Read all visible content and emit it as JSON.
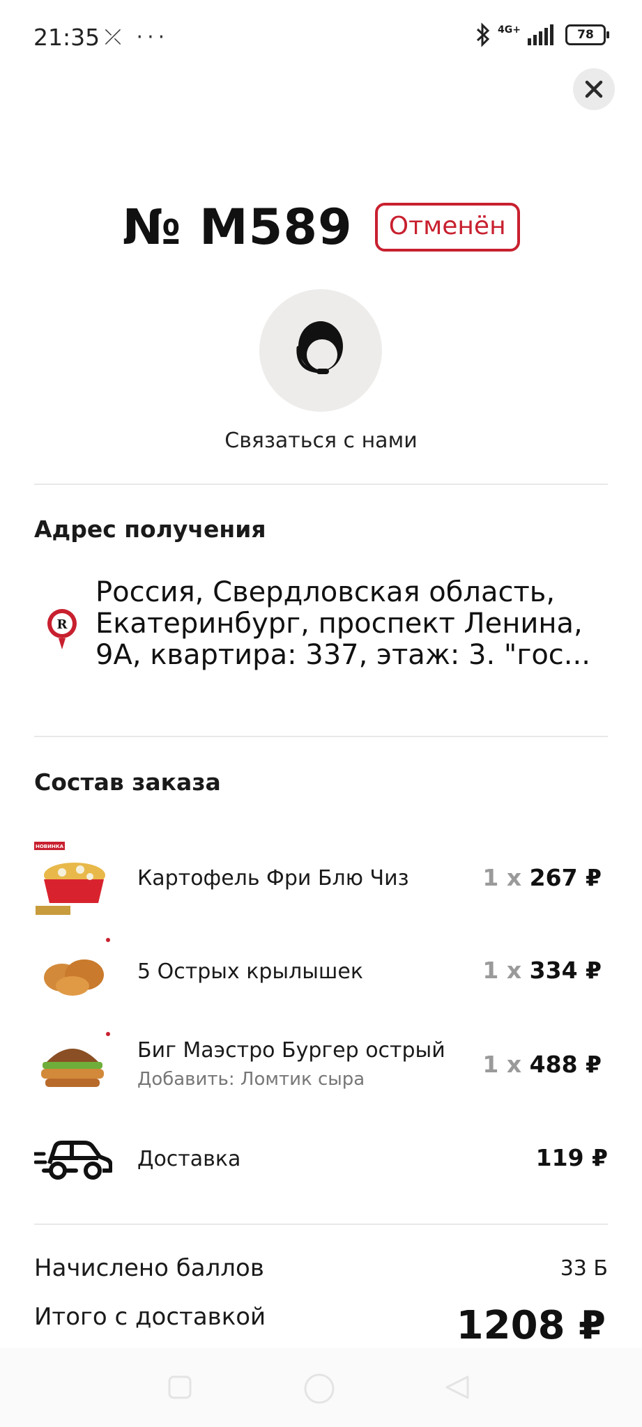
{
  "status_bar": {
    "time": "21:35",
    "extra_icons": "⤫ ···",
    "network": "4G+",
    "battery": "78"
  },
  "header": {
    "order_number": "№ М589",
    "order_status": "Отменён"
  },
  "support": {
    "label": "Связаться с нами"
  },
  "address": {
    "title": "Адрес получения",
    "text": "Россия, Свердловская область, Екатеринбург, проспект Ленина, 9А, квартира: 337, этаж: 3. \"гос...",
    "pin_letter": "R"
  },
  "order": {
    "title": "Состав заказа",
    "items": [
      {
        "name": "Картофель Фри Блю Чиз",
        "qty": "1 x",
        "price": "267 ₽",
        "badge": "НОВИНКА",
        "icon": "fries-image"
      },
      {
        "name": "5 Острых крылышек",
        "qty": "1 x",
        "price": "334 ₽",
        "icon": "wings-image"
      },
      {
        "name": "Биг Маэстро Бургер острый",
        "sub": "Добавить: Ломтик сыра",
        "qty": "1 x",
        "price": "488 ₽",
        "icon": "burger-image"
      }
    ],
    "delivery": {
      "label": "Доставка",
      "price": "119 ₽",
      "icon": "car-icon"
    }
  },
  "summary": {
    "points_label": "Начислено баллов",
    "points_value": "33 Б",
    "total_label": "Итого с доставкой",
    "total_value": "1208 ₽"
  },
  "colors": {
    "accent": "#c8202f",
    "support_bg": "#eeecea"
  }
}
